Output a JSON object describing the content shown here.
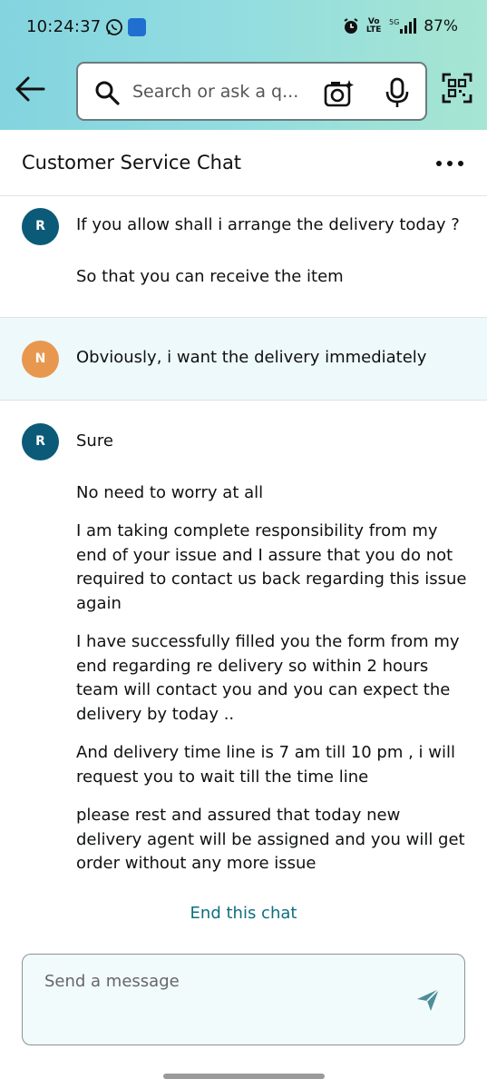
{
  "status_bar": {
    "time": "10:24:37",
    "network_label": "Vo LTE",
    "signal_label": "5G",
    "battery": "87%"
  },
  "search": {
    "placeholder": "Search or ask a q...",
    "icons": [
      "back-arrow-icon",
      "search-icon",
      "camera-lens-icon",
      "microphone-icon",
      "scan-code-icon"
    ]
  },
  "chat_header": {
    "title": "Customer Service Chat",
    "menu_icon": "more-dots-icon"
  },
  "messages": [
    {
      "sender_initial": "R",
      "lines": [
        "If you allow shall i arrange the delivery today ?",
        "So that you can receive the item"
      ]
    },
    {
      "sender_initial": "N",
      "lines": [
        "Obviously, i want the delivery immediately"
      ]
    },
    {
      "sender_initial": "R",
      "lines": [
        "Sure",
        "No need to worry at all",
        "I am taking complete responsibility from my end of your issue and I assure that you do not required to contact us back regarding this issue again",
        "I have successfully filled you the form from my end regarding re delivery so within 2 hours team will contact you and you can expect the delivery by today ..",
        "And delivery time line is 7 am till 10 pm , i will request you to wait till the time line",
        "please rest and assured that today new delivery agent will be assigned and you will get order without any more issue"
      ]
    }
  ],
  "end_chat_label": "End this chat",
  "composer": {
    "placeholder": "Send a message",
    "send_icon": "send-arrow-icon"
  },
  "colors": {
    "header_gradient_start": "#83d4df",
    "header_gradient_end": "#a6e5d1",
    "agent_avatar": "#0b5a78",
    "user_avatar": "#e8974f",
    "link": "#0e6f80",
    "user_msg_bg": "#eef9fb"
  }
}
